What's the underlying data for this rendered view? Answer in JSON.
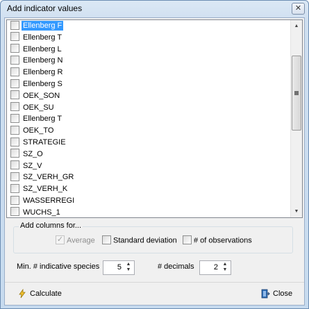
{
  "window": {
    "title": "Add indicator values",
    "close_glyph": "✕"
  },
  "list": {
    "items": [
      {
        "label": "Ellenberg F",
        "selected": true
      },
      {
        "label": "Ellenberg T"
      },
      {
        "label": "Ellenberg L"
      },
      {
        "label": "Ellenberg N"
      },
      {
        "label": "Ellenberg R"
      },
      {
        "label": "Ellenberg S"
      },
      {
        "label": "OEK_SON"
      },
      {
        "label": "OEK_SU"
      },
      {
        "label": "Ellenberg T"
      },
      {
        "label": "OEK_TO"
      },
      {
        "label": "STRATEGIE"
      },
      {
        "label": "SZ_O"
      },
      {
        "label": "SZ_V"
      },
      {
        "label": "SZ_VERH_GR"
      },
      {
        "label": "SZ_VERH_K"
      },
      {
        "label": "WASSERREGI"
      },
      {
        "label": "WUCHS_1"
      }
    ],
    "scroll_up_glyph": "▲",
    "scroll_down_glyph": "▼"
  },
  "columns_group": {
    "legend": "Add columns for...",
    "average_label": "Average",
    "average_checked": true,
    "average_disabled": true,
    "stddev_label": "Standard deviation",
    "nobs_label": "# of observations"
  },
  "settings": {
    "min_species_label": "Min. # indicative species",
    "min_species_value": "5",
    "decimals_label": "# decimals",
    "decimals_value": "2",
    "spin_arrows": "▲\n▼"
  },
  "buttons": {
    "calculate_label": "Calculate",
    "close_label": "Close"
  },
  "colors": {
    "selection": "#3399ff",
    "window_frame": "#c7dbef"
  },
  "icons": {
    "calculate": "calculate-icon",
    "close": "door-exit-icon"
  }
}
